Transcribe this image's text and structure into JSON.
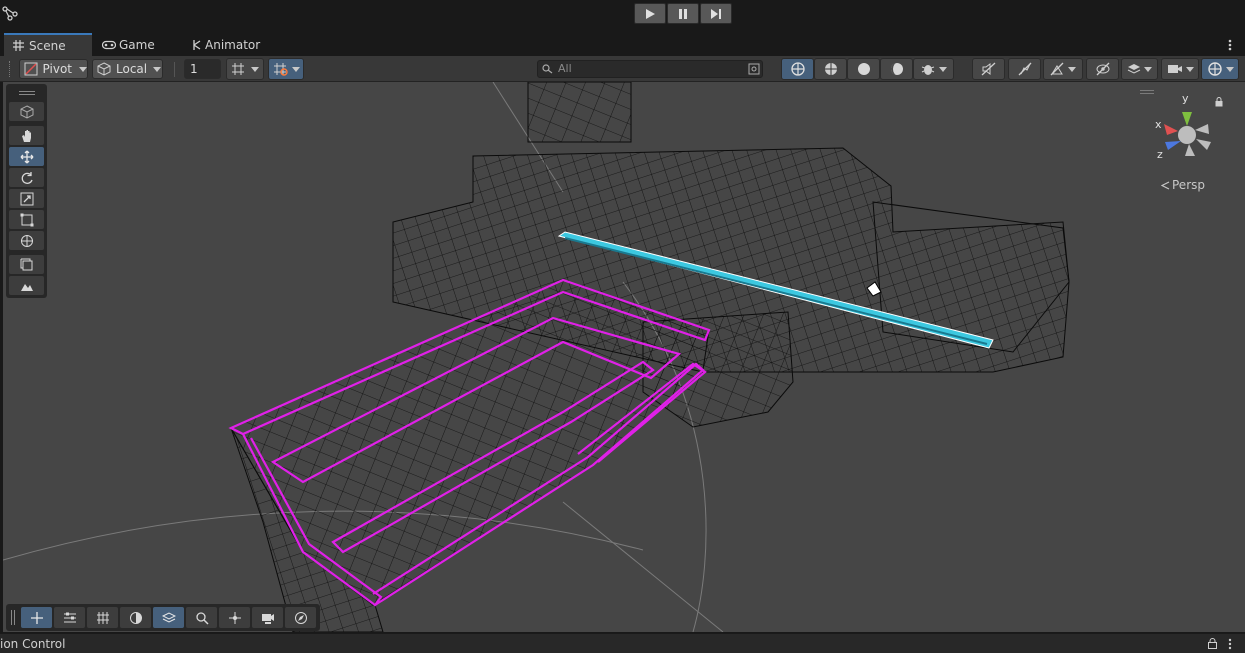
{
  "play_controls": {
    "play_icon": "play-icon",
    "pause_icon": "pause-icon",
    "step_icon": "step-icon"
  },
  "tabs": [
    {
      "label": "Scene",
      "icon": "grid-icon",
      "active": true
    },
    {
      "label": "Game",
      "icon": "gamepad-icon",
      "active": false
    },
    {
      "label": "Animator",
      "icon": "animator-icon",
      "active": false
    }
  ],
  "toolbar": {
    "pivot_label": "Pivot",
    "local_label": "Local",
    "grid_snap_value": "1",
    "search_placeholder": "All"
  },
  "gizmo": {
    "axis_x": "x",
    "axis_y": "y",
    "axis_z": "z",
    "projection_label": "Persp"
  },
  "status": {
    "text": "ion Control"
  },
  "colors": {
    "scene_bg": "#464646",
    "selection_magenta": "#e020e8",
    "highlight_cyan": "#3cc8e0",
    "accent_blue": "#3a79bb"
  }
}
